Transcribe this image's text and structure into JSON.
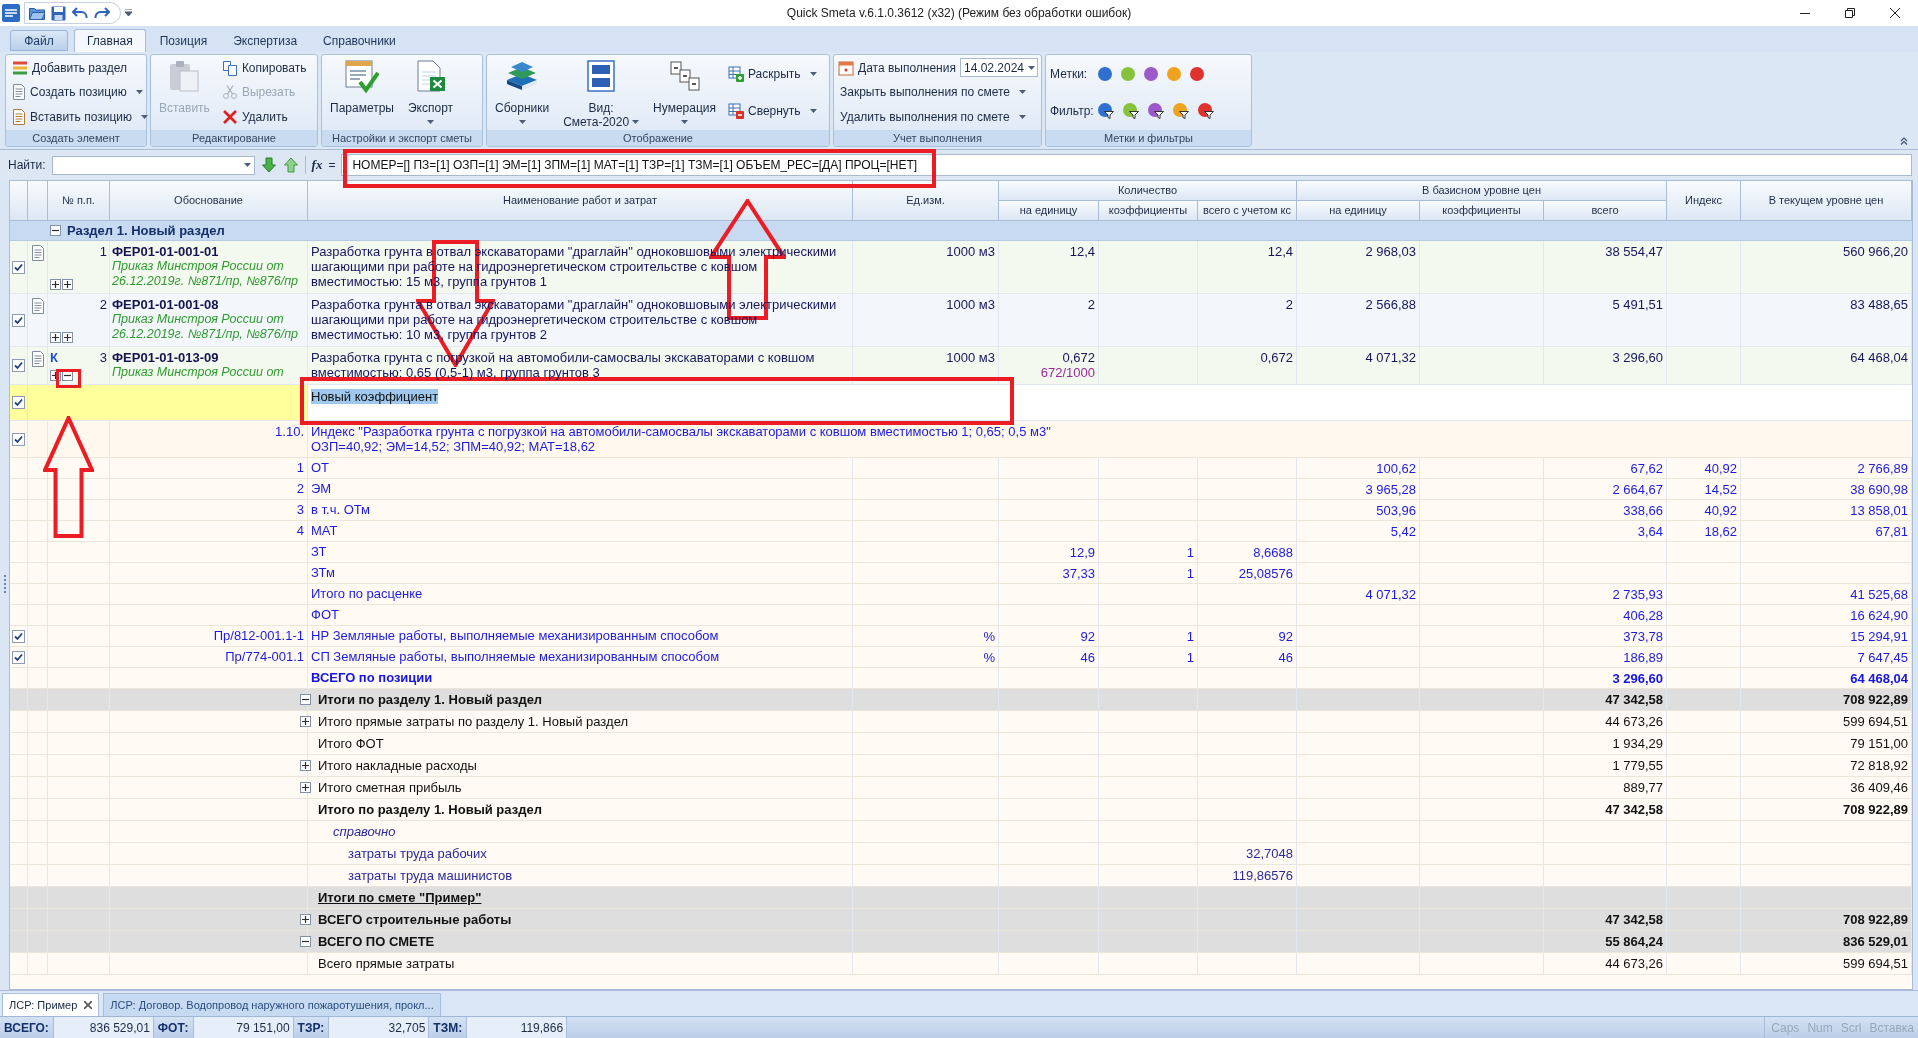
{
  "window": {
    "title": "Quick Smeta v.6.1.0.3612 (x32) (Режим без обработки ошибок)"
  },
  "ribbon_tabs": [
    {
      "label": "Файл",
      "kind": "file",
      "selected": false
    },
    {
      "label": "Главная",
      "kind": "tab",
      "selected": true
    },
    {
      "label": "Позиция",
      "kind": "tab",
      "selected": false
    },
    {
      "label": "Экспертиза",
      "kind": "tab",
      "selected": false
    },
    {
      "label": "Справочники",
      "kind": "tab",
      "selected": false
    }
  ],
  "ribbon_groups": [
    {
      "label": "Создать элемент",
      "items": [
        {
          "kind": "small",
          "label": "Добавить раздел",
          "dropdown": false,
          "disabled": false
        },
        {
          "kind": "small",
          "label": "Создать позицию",
          "dropdown": true,
          "disabled": false
        },
        {
          "kind": "small",
          "label": "Вставить позицию",
          "dropdown": true,
          "disabled": false
        }
      ]
    },
    {
      "label": "Редактирование",
      "items": [
        {
          "kind": "large",
          "label": "Вставить",
          "dropdown": false,
          "disabled": true
        },
        {
          "kind": "small",
          "label": "Копировать",
          "dropdown": false,
          "disabled": false
        },
        {
          "kind": "small",
          "label": "Вырезать",
          "dropdown": false,
          "disabled": true
        },
        {
          "kind": "small",
          "label": "Удалить",
          "dropdown": false,
          "disabled": false
        }
      ]
    },
    {
      "label": "Настройки и экспорт сметы",
      "items": [
        {
          "kind": "large",
          "label": "Параметры",
          "dropdown": false,
          "disabled": false
        },
        {
          "kind": "large",
          "label": "Экспорт",
          "dropdown": true,
          "disabled": false
        }
      ]
    },
    {
      "label": "Отображение",
      "items": [
        {
          "kind": "large",
          "label": "Сборники",
          "dropdown": true,
          "disabled": false
        },
        {
          "kind": "large",
          "label": "Вид:",
          "sublabel": "Смета-2020",
          "dropdown": true,
          "disabled": false
        },
        {
          "kind": "large",
          "label": "Нумерация",
          "dropdown": true,
          "disabled": false
        },
        {
          "kind": "small",
          "label": "Раскрыть",
          "dropdown": true,
          "disabled": false
        },
        {
          "kind": "small",
          "label": "Свернуть",
          "dropdown": true,
          "disabled": false
        }
      ]
    },
    {
      "label": "Учет выполнения",
      "items": [
        {
          "kind": "date",
          "label": "Дата выполнения",
          "value": "14.02.2024"
        },
        {
          "kind": "small",
          "label": "Закрыть выполнения по смете",
          "dropdown": true,
          "disabled": false
        },
        {
          "kind": "small",
          "label": "Удалить выполнения по смете",
          "dropdown": true,
          "disabled": false
        }
      ]
    },
    {
      "label": "Метки и фильтры",
      "items": [
        {
          "kind": "marks",
          "label": "Метки:",
          "marks": [
            {
              "color": "#2f6fd0"
            },
            {
              "color": "#86c23a"
            },
            {
              "color": "#9b59c9"
            },
            {
              "color": "#f0a21c"
            },
            {
              "color": "#e03131"
            }
          ]
        },
        {
          "kind": "filters",
          "label": "Фильтр:",
          "marks": [
            {
              "color": "#2f6fd0"
            },
            {
              "color": "#86c23a"
            },
            {
              "color": "#9b59c9"
            },
            {
              "color": "#f0a21c"
            },
            {
              "color": "#e03131"
            }
          ]
        }
      ]
    }
  ],
  "find_bar": {
    "label": "Найти:"
  },
  "formula_bar": {
    "icon_text": "fx",
    "sign": "=",
    "value": "НОМЕР=[] ПЗ=[1] ОЗП=[1] ЭМ=[1] ЗПМ=[1] МАТ=[1] ТЗР=[1] ТЗМ=[1] ОБЪЕМ_РЕС=[ДА] ПРОЦ=[НЕТ]"
  },
  "table": {
    "columns": [
      {
        "label": "№ п.п."
      },
      {
        "label": "Обоснование"
      },
      {
        "label": "Наименование работ и затрат"
      },
      {
        "label": "Ед.изм."
      },
      {
        "label": "Количество",
        "children": [
          {
            "label": "на единицу"
          },
          {
            "label": "коэффициенты"
          },
          {
            "label": "всего с учетом кс"
          }
        ]
      },
      {
        "label": "В базисном уровне цен",
        "children": [
          {
            "label": "на единицу"
          },
          {
            "label": "коэффициенты"
          },
          {
            "label": "всего"
          }
        ]
      },
      {
        "label": "Индекс"
      },
      {
        "label": "В текущем уровне цен"
      }
    ],
    "rows": [
      {
        "kind": "section",
        "expanded": true,
        "title": "Раздел 1. Новый раздел"
      },
      {
        "kind": "position",
        "checked": true,
        "num": "1",
        "code": "ФЕР01-01-001-01",
        "basis": "Приказ Минстроя России от 26.12.2019г. №871/пр, №876/пр",
        "name": "Разработка грунта в отвал экскаваторами \"драглайн\" одноковшовыми электрическими шагающими при работе на гидроэнергетическом строительстве с ковшом вместимостью: 15 м3, группа грунтов 1",
        "unit": "1000 м3",
        "qty_unit": "12,4",
        "qty_total": "12,4",
        "base_unit": "2 968,03",
        "base_total": "38 554,47",
        "current": "560 966,20",
        "toggles": [
          {
            "expanded": false
          },
          {
            "expanded": false
          }
        ]
      },
      {
        "kind": "position",
        "checked": true,
        "num": "2",
        "code": "ФЕР01-01-001-08",
        "basis": "Приказ Минстроя России от 26.12.2019г. №871/пр, №876/пр",
        "name": "Разработка грунта в отвал экскаваторами \"драглайн\" одноковшовыми электрическими шагающими при работе на гидроэнергетическом строительстве с ковшом вместимостью: 10 м3, группа грунтов 2",
        "unit": "1000 м3",
        "qty_unit": "2",
        "qty_total": "2",
        "base_unit": "2 566,88",
        "base_total": "5 491,51",
        "current": "83 488,65",
        "toggles": [
          {
            "expanded": false
          },
          {
            "expanded": false
          }
        ]
      },
      {
        "kind": "position",
        "checked": true,
        "marker": "К",
        "num": "3",
        "code": "ФЕР01-01-013-09",
        "basis": "Приказ Минстроя России от",
        "name": "Разработка грунта с погрузкой на автомобили-самосвалы экскаваторами с ковшом вместимостью: 0,65 (0,5-1) м3, группа грунтов 3",
        "unit": "1000 м3",
        "qty_unit": "0,672",
        "qty_formula": "672/1000",
        "qty_total": "0,672",
        "base_unit": "4 071,32",
        "base_total": "3 296,60",
        "current": "64 468,04",
        "toggles": [
          {
            "expanded": false
          },
          {
            "expanded": true
          }
        ]
      },
      {
        "kind": "edit",
        "checked": true,
        "value": "Новый коэффициент",
        "value_selected": true
      },
      {
        "kind": "index",
        "checked": true,
        "num": "1.10.",
        "lines": [
          "Индекс \"Разработка грунта с погрузкой на автомобили-самосвалы экскаваторами с ковшом вместимостью 1; 0,65; 0,5 м3\"",
          "ОЗП=40,92; ЭМ=14,52; ЗПМ=40,92; МАТ=18,62"
        ]
      },
      {
        "kind": "resource",
        "num": "1",
        "name": "ОТ",
        "base_unit": "100,62",
        "base_total": "67,62",
        "index": "40,92",
        "current": "2 766,89"
      },
      {
        "kind": "resource",
        "num": "2",
        "name": "ЭМ",
        "base_unit": "3 965,28",
        "base_total": "2 664,67",
        "index": "14,52",
        "current": "38 690,98"
      },
      {
        "kind": "resource",
        "num": "3",
        "name": "в т.ч. ОТм",
        "base_unit": "503,96",
        "base_total": "338,66",
        "index": "40,92",
        "current": "13 858,01"
      },
      {
        "kind": "resource",
        "num": "4",
        "name": "МАТ",
        "base_unit": "5,42",
        "base_total": "3,64",
        "index": "18,62",
        "current": "67,81"
      },
      {
        "kind": "resource",
        "name": "ЗТ",
        "qty_unit": "12,9",
        "qty_coef": "1",
        "qty_total": "8,6688"
      },
      {
        "kind": "resource",
        "name": "ЗТм",
        "qty_unit": "37,33",
        "qty_coef": "1",
        "qty_total": "25,08576"
      },
      {
        "kind": "resource",
        "name": "Итого по расценке",
        "base_unit": "4 071,32",
        "base_total": "2 735,93",
        "current": "41 525,68"
      },
      {
        "kind": "resource",
        "name": "ФОТ",
        "base_total": "406,28",
        "current": "16 624,90"
      },
      {
        "kind": "overhead",
        "checked": true,
        "num": "Пр/812-001.1-1",
        "name": "НР Земляные работы, выполняемые механизированным способом",
        "unit": "%",
        "qty_unit": "92",
        "qty_coef": "1",
        "qty_total": "92",
        "base_total": "373,78",
        "current": "15 294,91"
      },
      {
        "kind": "overhead",
        "checked": true,
        "num": "Пр/774-001.1",
        "name": "СП Земляные работы, выполняемые механизированным способом",
        "unit": "%",
        "qty_unit": "46",
        "qty_coef": "1",
        "qty_total": "46",
        "base_total": "186,89",
        "current": "7 647,45"
      },
      {
        "kind": "position_total",
        "name": "ВСЕГО по позиции",
        "base_total": "3 296,60",
        "current": "64 468,04"
      },
      {
        "kind": "band",
        "expanded": true,
        "name": "Итоги по разделу 1. Новый раздел",
        "base_total": "47 342,58",
        "current": "708 922,89"
      },
      {
        "kind": "line",
        "expanded": false,
        "name": "Итого прямые затраты по разделу 1. Новый раздел",
        "base_total": "44 673,26",
        "current": "599 694,51"
      },
      {
        "kind": "line",
        "name": "Итого ФОТ",
        "base_total": "1 934,29",
        "current": "79 151,00"
      },
      {
        "kind": "line",
        "expanded": false,
        "name": "Итого накладные расходы",
        "base_total": "1 779,55",
        "current": "72 818,92"
      },
      {
        "kind": "line",
        "expanded": false,
        "name": "Итого сметная прибыль",
        "base_total": "889,77",
        "current": "36 409,46"
      },
      {
        "kind": "total_line",
        "name": "Итого по разделу 1. Новый раздел",
        "base_total": "47 342,58",
        "current": "708 922,89",
        "children": [
          {
            "kind": "note",
            "name": "справочно",
            "children": [
              {
                "kind": "detail",
                "name": "затраты труда рабочих",
                "qty_total": "32,7048"
              },
              {
                "kind": "detail",
                "name": "затраты труда машинистов",
                "qty_total": "119,86576"
              }
            ]
          }
        ]
      },
      {
        "kind": "band_title",
        "name": "Итоги по смете \"Пример\""
      },
      {
        "kind": "band",
        "expanded": false,
        "name": "ВСЕГО строительные работы",
        "base_total": "47 342,58",
        "current": "708 922,89"
      },
      {
        "kind": "band",
        "expanded": true,
        "name": "ВСЕГО ПО СМЕТЕ",
        "base_total": "55 864,24",
        "current": "836 529,01"
      },
      {
        "kind": "line",
        "name": "Всего прямые затраты",
        "base_total": "44 673,26",
        "current": "599 694,51"
      }
    ]
  },
  "document_tabs": [
    {
      "label": "ЛСР: Пример",
      "selected": true,
      "closable": true
    },
    {
      "label": "ЛСР: Договор. Водопровод наружного пожаротушения, прокл...",
      "selected": false,
      "closable": false
    }
  ],
  "status_bar": {
    "fields": [
      {
        "label": "ВСЕГО:",
        "value": "836 529,01"
      },
      {
        "label": "ФОТ:",
        "value": "79 151,00"
      },
      {
        "label": "ТЗР:",
        "value": "32,705"
      },
      {
        "label": "ТЗМ:",
        "value": "119,866"
      }
    ],
    "indicators": [
      {
        "label": "Caps",
        "on": false
      },
      {
        "label": "Num",
        "on": false
      },
      {
        "label": "Scrl",
        "on": false
      },
      {
        "label": "Вставка",
        "on": false
      }
    ]
  }
}
